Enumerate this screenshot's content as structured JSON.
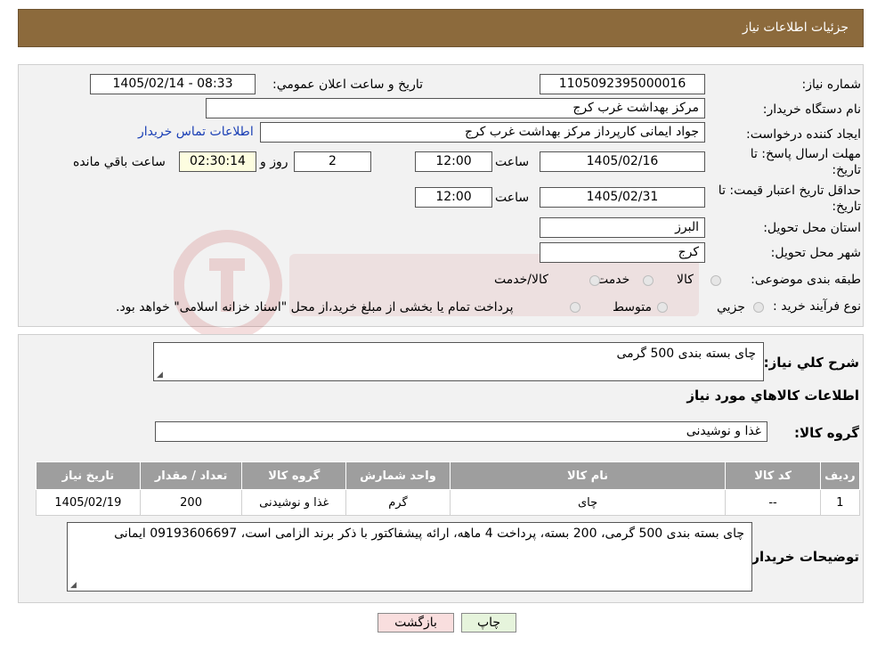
{
  "header": {
    "title": "جزئیات اطلاعات نیاز"
  },
  "form": {
    "need_number_label": "شماره نیاز:",
    "need_number": "1105092395000016",
    "announce_label": "تاریخ و ساعت اعلان عمومي:",
    "announce_value": "1405/02/14 - 08:33",
    "buyer_org_label": "نام دستگاه خريدار:",
    "buyer_org": "مرکز بهداشت غرب کرج",
    "creator_label": "ايجاد کننده درخواست:",
    "creator": "جواد ایمانی کارپرداز مرکز بهداشت غرب کرج",
    "contact_link": "اطلاعات تماس خريدار",
    "deadline_label_1": "مهلت ارسال پاسخ: تا",
    "deadline_label_2": "تاريخ:",
    "deadline_date": "1405/02/16",
    "time_label": "ساعت",
    "deadline_time": "12:00",
    "days_value": "2",
    "days_label": "روز و",
    "remaining_time": "02:30:14",
    "remaining_label": "ساعت باقي مانده",
    "validity_label_1": "حداقل تاريخ اعتبار قيمت: تا",
    "validity_label_2": "تاريخ:",
    "validity_date": "1405/02/31",
    "validity_time": "12:00",
    "province_label": "استان محل تحويل:",
    "province": "البرز",
    "city_label": "شهر محل تحويل:",
    "city": "کرج",
    "category_label": "طبقه بندی موضوعی:",
    "category_options": [
      "کالا",
      "خدمت",
      "کالا/خدمت"
    ],
    "process_label": "نوع فرآيند خريد :",
    "process_options": [
      "جزيي",
      "متوسط"
    ],
    "process_note": "پرداخت تمام يا بخشی از مبلغ خريد،از محل \"اسناد خزانه اسلامی\" خواهد بود."
  },
  "details": {
    "summary_label": "شرح كلي نياز:",
    "summary": "چای بسته بندی 500 گرمی",
    "goods_info_title": "اطلاعات كالاهاي مورد نياز",
    "goods_group_label": "گروه کالا:",
    "goods_group": "غذا و نوشیدنی",
    "table": {
      "headers": [
        "رديف",
        "کد کالا",
        "نام کالا",
        "واحد شمارش",
        "گروه کالا",
        "تعداد / مقدار",
        "تاریخ نیاز"
      ],
      "rows": [
        [
          "1",
          "--",
          "چای",
          "گرم",
          "غذا و نوشیدنی",
          "200",
          "1405/02/19"
        ]
      ]
    },
    "buyer_notes_label": "توضيحات خريدار:",
    "buyer_notes": "چای بسته بندی 500 گرمی، 200 بسته، پرداخت 4 ماهه، ارائه پیشفاکتور با ذکر برند الزامی است، 09193606697 ایمانی"
  },
  "buttons": {
    "print": "چاپ",
    "back": "بازگشت"
  },
  "colors": {
    "header": "#8c6a3c",
    "table_header": "#9e9e9e",
    "link": "#1a3fb5"
  }
}
